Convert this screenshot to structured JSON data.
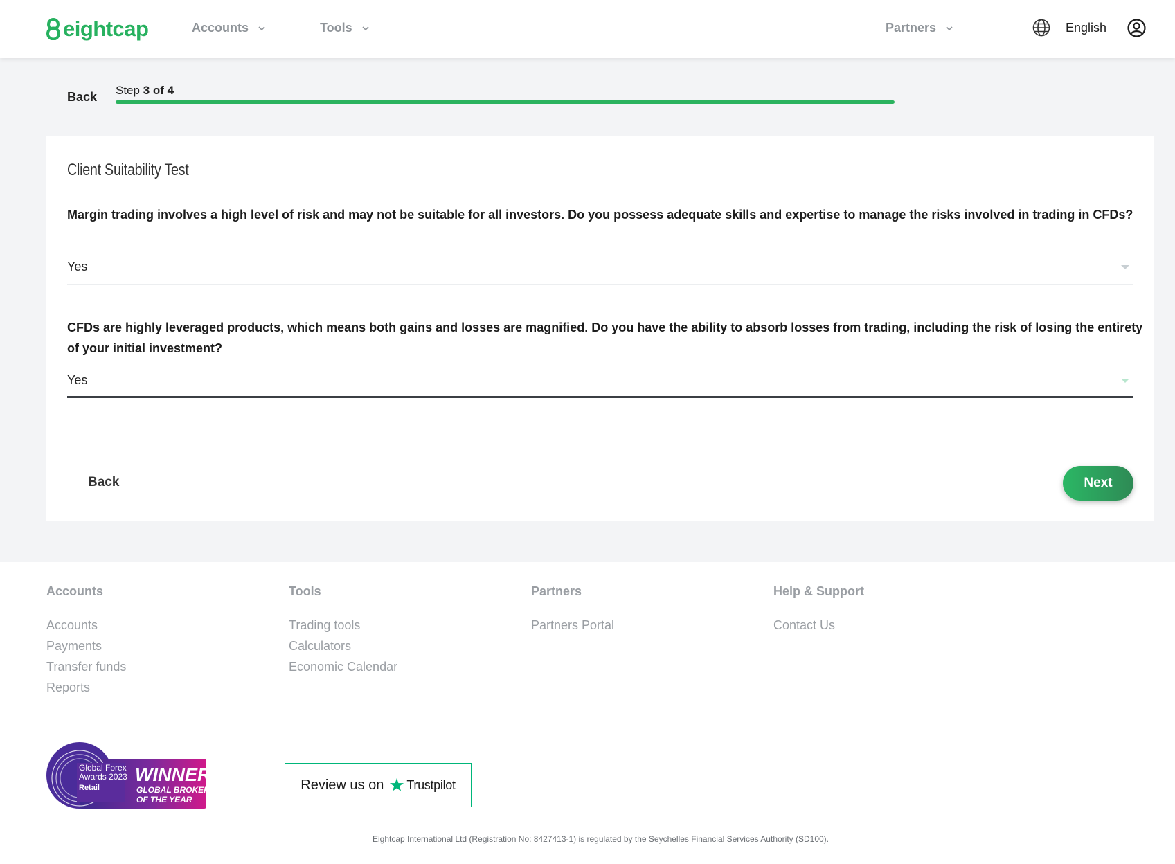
{
  "header": {
    "logo_text": "eightcap",
    "nav": [
      {
        "label": "Accounts"
      },
      {
        "label": "Tools"
      },
      {
        "label": "Partners"
      }
    ],
    "language": "English"
  },
  "stepper": {
    "back_label": "Back",
    "step_prefix": "Step",
    "step_value": "3 of 4",
    "progress": 1.0
  },
  "form": {
    "title": "Client Suitability Test",
    "questions": [
      {
        "text": "Margin trading involves a high level of risk and may not be suitable for all investors. Do you possess adequate skills and expertise to manage the risks involved in trading in CFDs?",
        "answer": "Yes"
      },
      {
        "text": "CFDs are highly leveraged products, which means both gains and losses are magnified. Do you have the ability to absorb losses from trading, including the risk of losing the entirety of your initial investment?",
        "answer": "Yes"
      }
    ],
    "back_label": "Back",
    "next_label": "Next"
  },
  "footer": {
    "columns": [
      {
        "heading": "Accounts",
        "links": [
          "Accounts",
          "Payments",
          "Transfer funds",
          "Reports"
        ]
      },
      {
        "heading": "Tools",
        "links": [
          "Trading tools",
          "Calculators",
          "Economic Calendar"
        ]
      },
      {
        "heading": "Partners",
        "links": [
          "Partners Portal"
        ]
      },
      {
        "heading": "Help & Support",
        "links": [
          "Contact Us"
        ]
      }
    ],
    "badge": {
      "line1": "Global Forex",
      "line2": "Awards 2023",
      "line3": "Retail",
      "winner": "WINNER",
      "sub1": "GLOBAL BROKER",
      "sub2": "OF THE YEAR"
    },
    "trustpilot": {
      "text": "Review us on",
      "brand": "Trustpilot"
    },
    "legal": "Eightcap International Ltd (Registration No: 8427413-1) is regulated by the Seychelles Financial Services Authority (SD100)."
  },
  "colors": {
    "brand_green": "#27b15f",
    "progress_green": "#2bb35f",
    "trustpilot_green": "#00b67a"
  }
}
